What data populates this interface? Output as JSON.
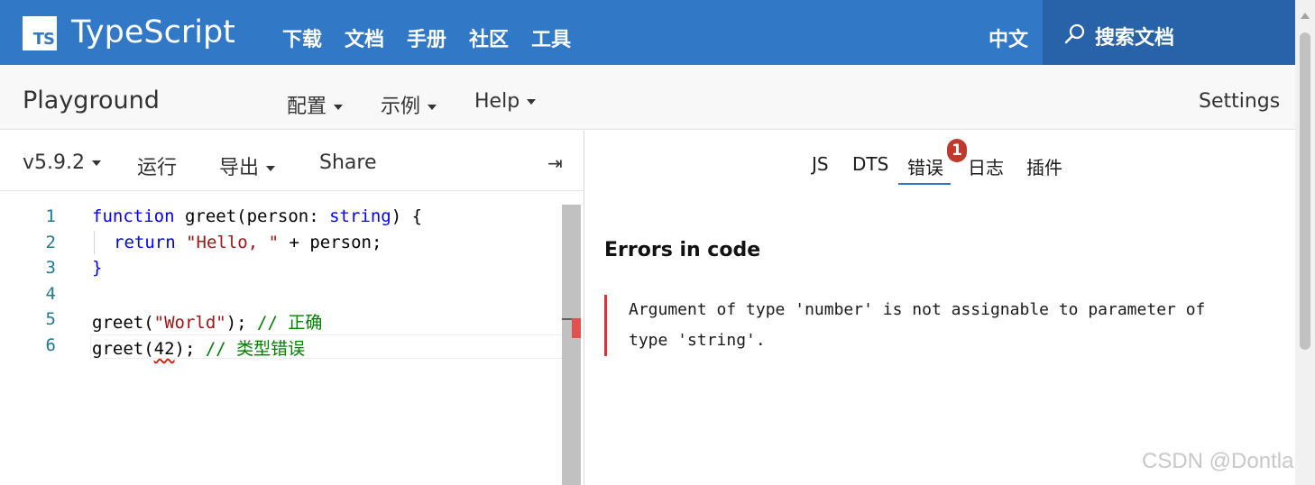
{
  "topnav": {
    "logo_text": "TS",
    "brand": "TypeScript",
    "links": [
      "下载",
      "文档",
      "手册",
      "社区",
      "工具"
    ],
    "language": "中文",
    "search_label": "搜索文档",
    "accent_color": "#3178c6"
  },
  "subnav": {
    "title": "Playground",
    "config": "配置",
    "examples": "示例",
    "help": "Help",
    "settings": "Settings"
  },
  "toolbar": {
    "version": "v5.9.2",
    "run": "运行",
    "export": "导出",
    "share": "Share",
    "collapse_icon": "⇥"
  },
  "editor": {
    "line_numbers": [
      "1",
      "2",
      "3",
      "4",
      "5",
      "6"
    ],
    "line1": {
      "kw": "function",
      "a": " greet(person: ",
      "type": "string",
      "b": ") {"
    },
    "line2": {
      "kw": "return",
      "str": "\"Hello, \"",
      "rest": " + person;"
    },
    "line3": "}",
    "line5": {
      "a": "greet(",
      "str": "\"World\"",
      "b": "); ",
      "comment": "// 正确"
    },
    "line6": {
      "a": "greet(",
      "err": "42",
      "b": "); ",
      "comment": "// 类型错误"
    }
  },
  "right_tabs": {
    "js": "JS",
    "dts": "DTS",
    "errors": "错误",
    "errors_count": "1",
    "logs": "日志",
    "plugins": "插件"
  },
  "errors": {
    "heading": "Errors in code",
    "line1": "Argument of type 'number' is not assignable to parameter of",
    "line2": "type 'string'."
  },
  "watermark": "CSDN @Dontla"
}
